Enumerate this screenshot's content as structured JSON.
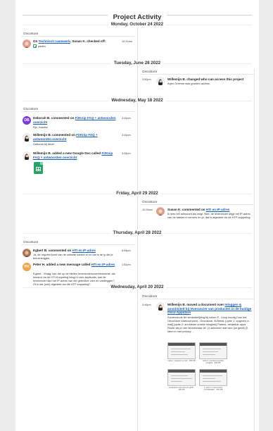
{
  "page": {
    "title": "Project Activity"
  },
  "colors": {
    "link": "#1a5fb4",
    "check": "#2e9e5b",
    "avatar_db": "#7a3bd8",
    "avatar_ph": "#f2a54a",
    "sheets": "#23a566"
  },
  "sections": {
    "d1": {
      "date": "Monday, October 24 2022",
      "project": "Oncostore",
      "e1": {
        "actor": "On ",
        "link": "Technisch raamwerk",
        "rest": ", Susan K. checked off:",
        "time": "10:31am",
        "item": "paden"
      }
    },
    "d2": {
      "date": "Tuesday, June 28 2022",
      "project": "Oncostore",
      "e1": {
        "headline": "Willemijn B. changed who can access this project",
        "time": "3:50pm",
        "body": "Arjen Greeme was granted access."
      }
    },
    "d3": {
      "date": "Wednesday, May 18 2022",
      "project": "Oncostore",
      "e1": {
        "avatar": "DB",
        "actor": "Deborah B. commented on ",
        "link": "FitKnip FAQ + antwoorden overzicht",
        "time": "3:40pm",
        "body": "Fijn, thanks!"
      },
      "e2": {
        "actor": "Willemijn B. commented on ",
        "link": "FitKnip FAQ + antwoorden overzicht",
        "time": "3:40pm",
        "body": "Deborah bij deze!"
      },
      "e3": {
        "actor": "Willemijn B. added a new Google Doc called ",
        "link": "FitKnip FAQ + antwoorden overzicht",
        "time": "3:36pm",
        "icon": "google-sheets-icon"
      }
    },
    "d4": {
      "date": "Friday, April 29 2022",
      "project": "Oncostore",
      "e1": {
        "actor": "Susan K. commented on ",
        "link": "HTI en IP-adres",
        "time": "10:26am",
        "body": "Ik lees het antwoord als volgt. Nee, de leverancier krijgt het IP-adres van de kanker.nl servers en ja, dat is afgedekt via de HTP-koppeling."
      }
    },
    "d5": {
      "date": "Thursday, April 28 2022",
      "project": "Oncostore",
      "e1": {
        "actor": "Egbert B. commented on ",
        "link": "HTI en IP-adres",
        "time": "6:08pm",
        "body": "Ja, de request komt van de website kanker.nl en dat is de ip die je binnenkrijgen."
      },
      "e2": {
        "avatar": "PH",
        "actor": "Peter H. added a new message called ",
        "link": "HTI en IP-adres",
        "time": "1:52pm",
        "body": "Egbert - Vraag: kan die op de stellen leveranciersovereenkomst: als iemand via de HTI-Koppeling inlogt in een applicatie, kan de leverancier dan het IP-adres van die gebruiker zien en vastleggen? Of is dat (ook) afgedekt via die HTP koppeling?"
      }
    },
    "d6": {
      "date": "Wednesday, April 20 2022",
      "project": "Oncostore",
      "e1": {
        "actor": "Willemijn B. moved a document over ",
        "link": "Inloggen & anonimiteit bij leverancier van producten in de huidige Onco Appstore",
        "time": "3:46pm",
        "body": "Screenshots ter verduidelijking bij kolom E - inlog noodig?van het OncoStore startoverzicht - Oncostore. B-Beeld: [optie 1: opgeven e-mail] [optie 2: anonieme unieke inloglink] Patient- belaadde apps Route als je niet verzekeraar zit: (1 selecteer wat voor jou geldt) [2. stem in met privacy ...",
        "thumbs": [
          "optie 1: opgeven e-mail · 383 KB",
          "optie 2: anonieme unieke inloglink · 350 KB",
          "1 selecteer wat voor jou geldt · 400 KB",
          "2. stem in met privacy voorwaarden · 363 KB"
        ]
      }
    }
  }
}
